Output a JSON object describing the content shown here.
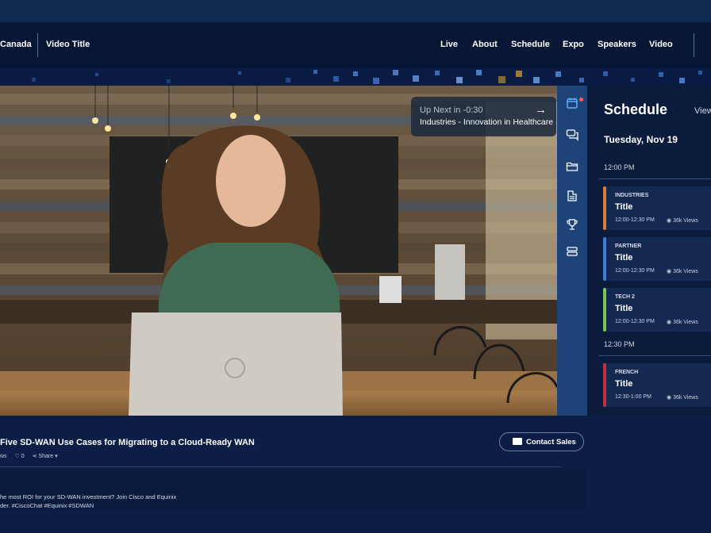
{
  "header": {
    "brand": "Canada",
    "video_title": "Video Title",
    "nav": [
      "Live",
      "About",
      "Schedule",
      "Expo",
      "Speakers",
      "Video"
    ]
  },
  "up_next": {
    "label": "Up Next in -0:30",
    "title": "Industries - Innovation in Healthcare"
  },
  "rail_icons": [
    "calendar-icon",
    "chat-icon",
    "folder-icon",
    "document-icon",
    "trophy-icon",
    "server-icon"
  ],
  "schedule": {
    "title": "Schedule",
    "view_all": "View",
    "date": "Tuesday, Nov 19",
    "slots": [
      {
        "time": "12:00 PM",
        "sessions": [
          {
            "tag": "INDUSTRIES",
            "title": "Title",
            "time": "12:00-12:30 PM",
            "views": "36k Views",
            "color": "#e07b39"
          },
          {
            "tag": "PARTNER",
            "title": "Title",
            "time": "12:00-12:30 PM",
            "views": "36k Views",
            "color": "#3c7fd4"
          },
          {
            "tag": "TECH 2",
            "title": "Title",
            "time": "12:00-12:30 PM",
            "views": "36k Views",
            "color": "#79c55c"
          }
        ]
      },
      {
        "time": "12:30 PM",
        "sessions": [
          {
            "tag": "FRENCH",
            "title": "Title",
            "time": "12:30-1:00 PM",
            "views": "36k Views",
            "color": "#c2303c"
          }
        ]
      }
    ]
  },
  "video_info": {
    "title": "Five SD-WAN Use Cases for Migrating to a Cloud-Ready WAN",
    "views_fragment": "ws",
    "likes": "0",
    "share": "Share",
    "contact_button": "Contact Sales",
    "description": [
      "he most ROI for your SD-WAN investment? Join Cisco and Equinix",
      "der. #CiscoChat #Equinix #SDWAN"
    ]
  }
}
